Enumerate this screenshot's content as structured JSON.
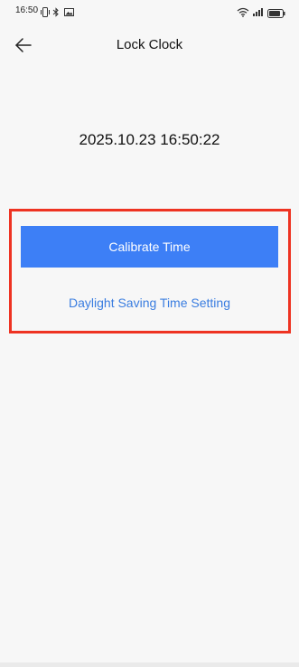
{
  "status_bar": {
    "time": "16:50",
    "icons": [
      "vibrate-icon",
      "bluetooth-icon",
      "photo-icon",
      "wifi-icon",
      "signal-icon",
      "battery-icon"
    ]
  },
  "header": {
    "back_icon": "arrow-left-icon",
    "title": "Lock Clock"
  },
  "clock": {
    "datetime": "2025.10.23 16:50:22"
  },
  "actions": {
    "calibrate_label": "Calibrate Time",
    "dst_label": "Daylight Saving Time Setting"
  },
  "colors": {
    "background": "#f7f7f7",
    "primary": "#3d7ff6",
    "link": "#3a7de0",
    "highlight": "#ee3322"
  }
}
